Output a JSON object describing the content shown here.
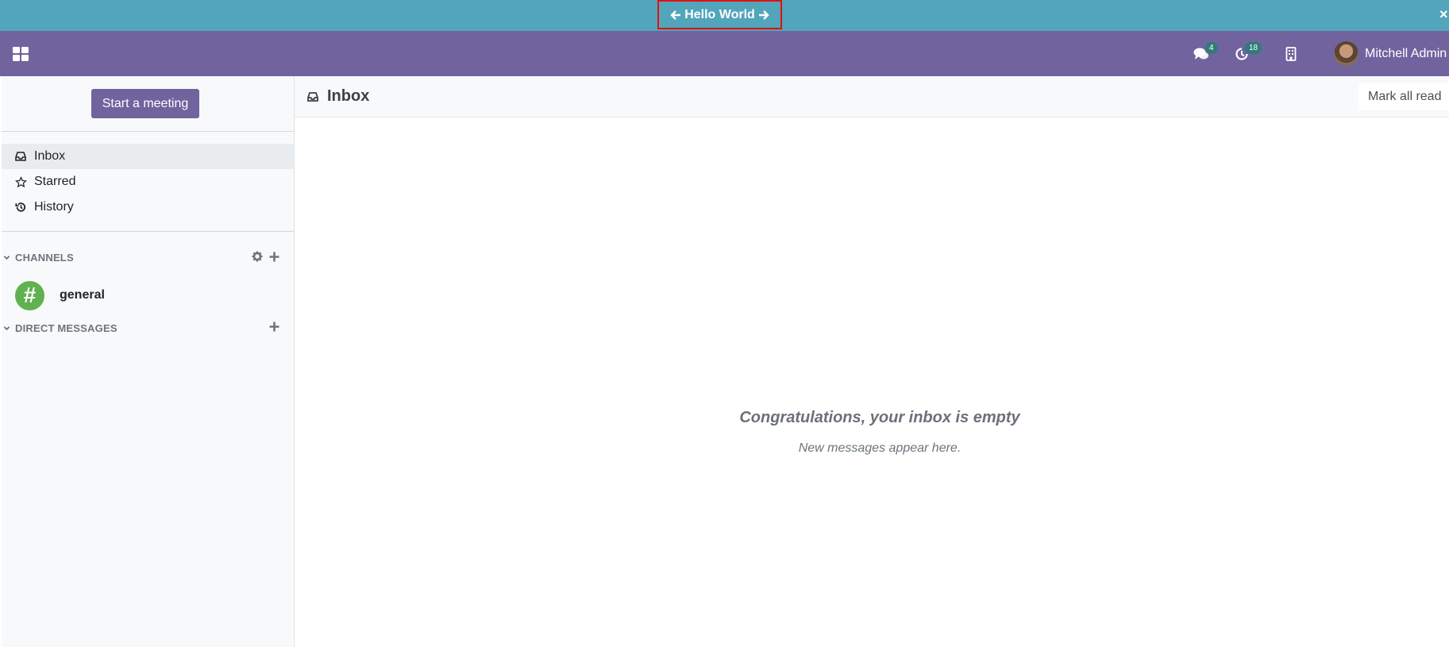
{
  "banner": {
    "title": "Hello World"
  },
  "navbar": {
    "apps_icon": "apps-grid-icon",
    "messages_badge": "4",
    "activities_badge": "18",
    "user_name": "Mitchell Admin"
  },
  "sidebar": {
    "meeting_button": "Start a meeting",
    "items": [
      {
        "label": "Inbox",
        "icon": "inbox-icon",
        "active": true
      },
      {
        "label": "Starred",
        "icon": "star-icon",
        "active": false
      },
      {
        "label": "History",
        "icon": "history-icon",
        "active": false
      }
    ],
    "channels_label": "CHANNELS",
    "channels": [
      {
        "name": "general",
        "icon": "hash-icon",
        "color": "#5fb24f"
      }
    ],
    "dm_label": "DIRECT MESSAGES"
  },
  "main": {
    "title": "Inbox",
    "mark_all_read": "Mark all read",
    "empty_title": "Congratulations, your inbox is empty",
    "empty_subtitle": "New messages appear here."
  },
  "colors": {
    "banner": "#52a5ba",
    "navbar": "#71639e",
    "primary": "#71639e",
    "badge": "#2e7c7a"
  }
}
